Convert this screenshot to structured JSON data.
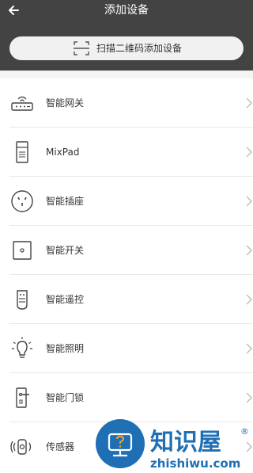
{
  "header": {
    "title": "添加设备",
    "back_icon": "arrow-left-icon",
    "scan_button_label": "扫描二维码添加设备",
    "scan_icon": "qr-scan-icon",
    "background": "#434343"
  },
  "devices": [
    {
      "label": "智能网关",
      "icon": "gateway-icon"
    },
    {
      "label": "MixPad",
      "icon": "mixpad-icon"
    },
    {
      "label": "智能插座",
      "icon": "socket-icon"
    },
    {
      "label": "智能开关",
      "icon": "switch-icon"
    },
    {
      "label": "智能遥控",
      "icon": "remote-icon"
    },
    {
      "label": "智能照明",
      "icon": "bulb-icon"
    },
    {
      "label": "智能门锁",
      "icon": "door-lock-icon"
    },
    {
      "label": "传感器",
      "icon": "sensor-icon"
    }
  ],
  "watermark": {
    "brand": "知识屋",
    "registered": "®",
    "domain": "zhishiwu.com",
    "color": "#1f6fb4"
  }
}
